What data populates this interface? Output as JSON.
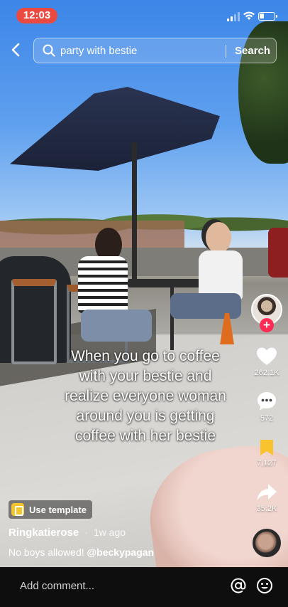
{
  "status_bar": {
    "time": "12:03",
    "battery_level_fraction": 0.3,
    "signal_bars_active": 2,
    "signal_bars_total": 4
  },
  "search": {
    "query": "party with bestie",
    "button_label": "Search"
  },
  "video": {
    "caption_lines": [
      "When you go to coffee",
      "with your bestie and",
      "realize everyone woman",
      "around you is getting",
      "coffee with her bestie"
    ]
  },
  "actions": {
    "follow_symbol": "+",
    "likes": "262.1K",
    "comments": "572",
    "saves": "7,127",
    "shares": "35.2K"
  },
  "post": {
    "template_label": "Use template",
    "author": "Ringkatierose",
    "separator": "·",
    "time_ago": "1w ago",
    "description_text": "No boys allowed! ",
    "mention": "@beckypagan"
  },
  "comment_bar": {
    "placeholder": "Add comment..."
  },
  "colors": {
    "accent_red": "#fe2c55",
    "save_yellow": "#f8c32c",
    "clock_pill": "#ea4a3f"
  },
  "icons": [
    "back-chevron-icon",
    "search-icon",
    "heart-icon",
    "comment-icon",
    "bookmark-icon",
    "share-arrow-icon",
    "template-icon",
    "at-icon",
    "emoji-icon",
    "signal-icon",
    "wifi-icon",
    "battery-icon"
  ]
}
